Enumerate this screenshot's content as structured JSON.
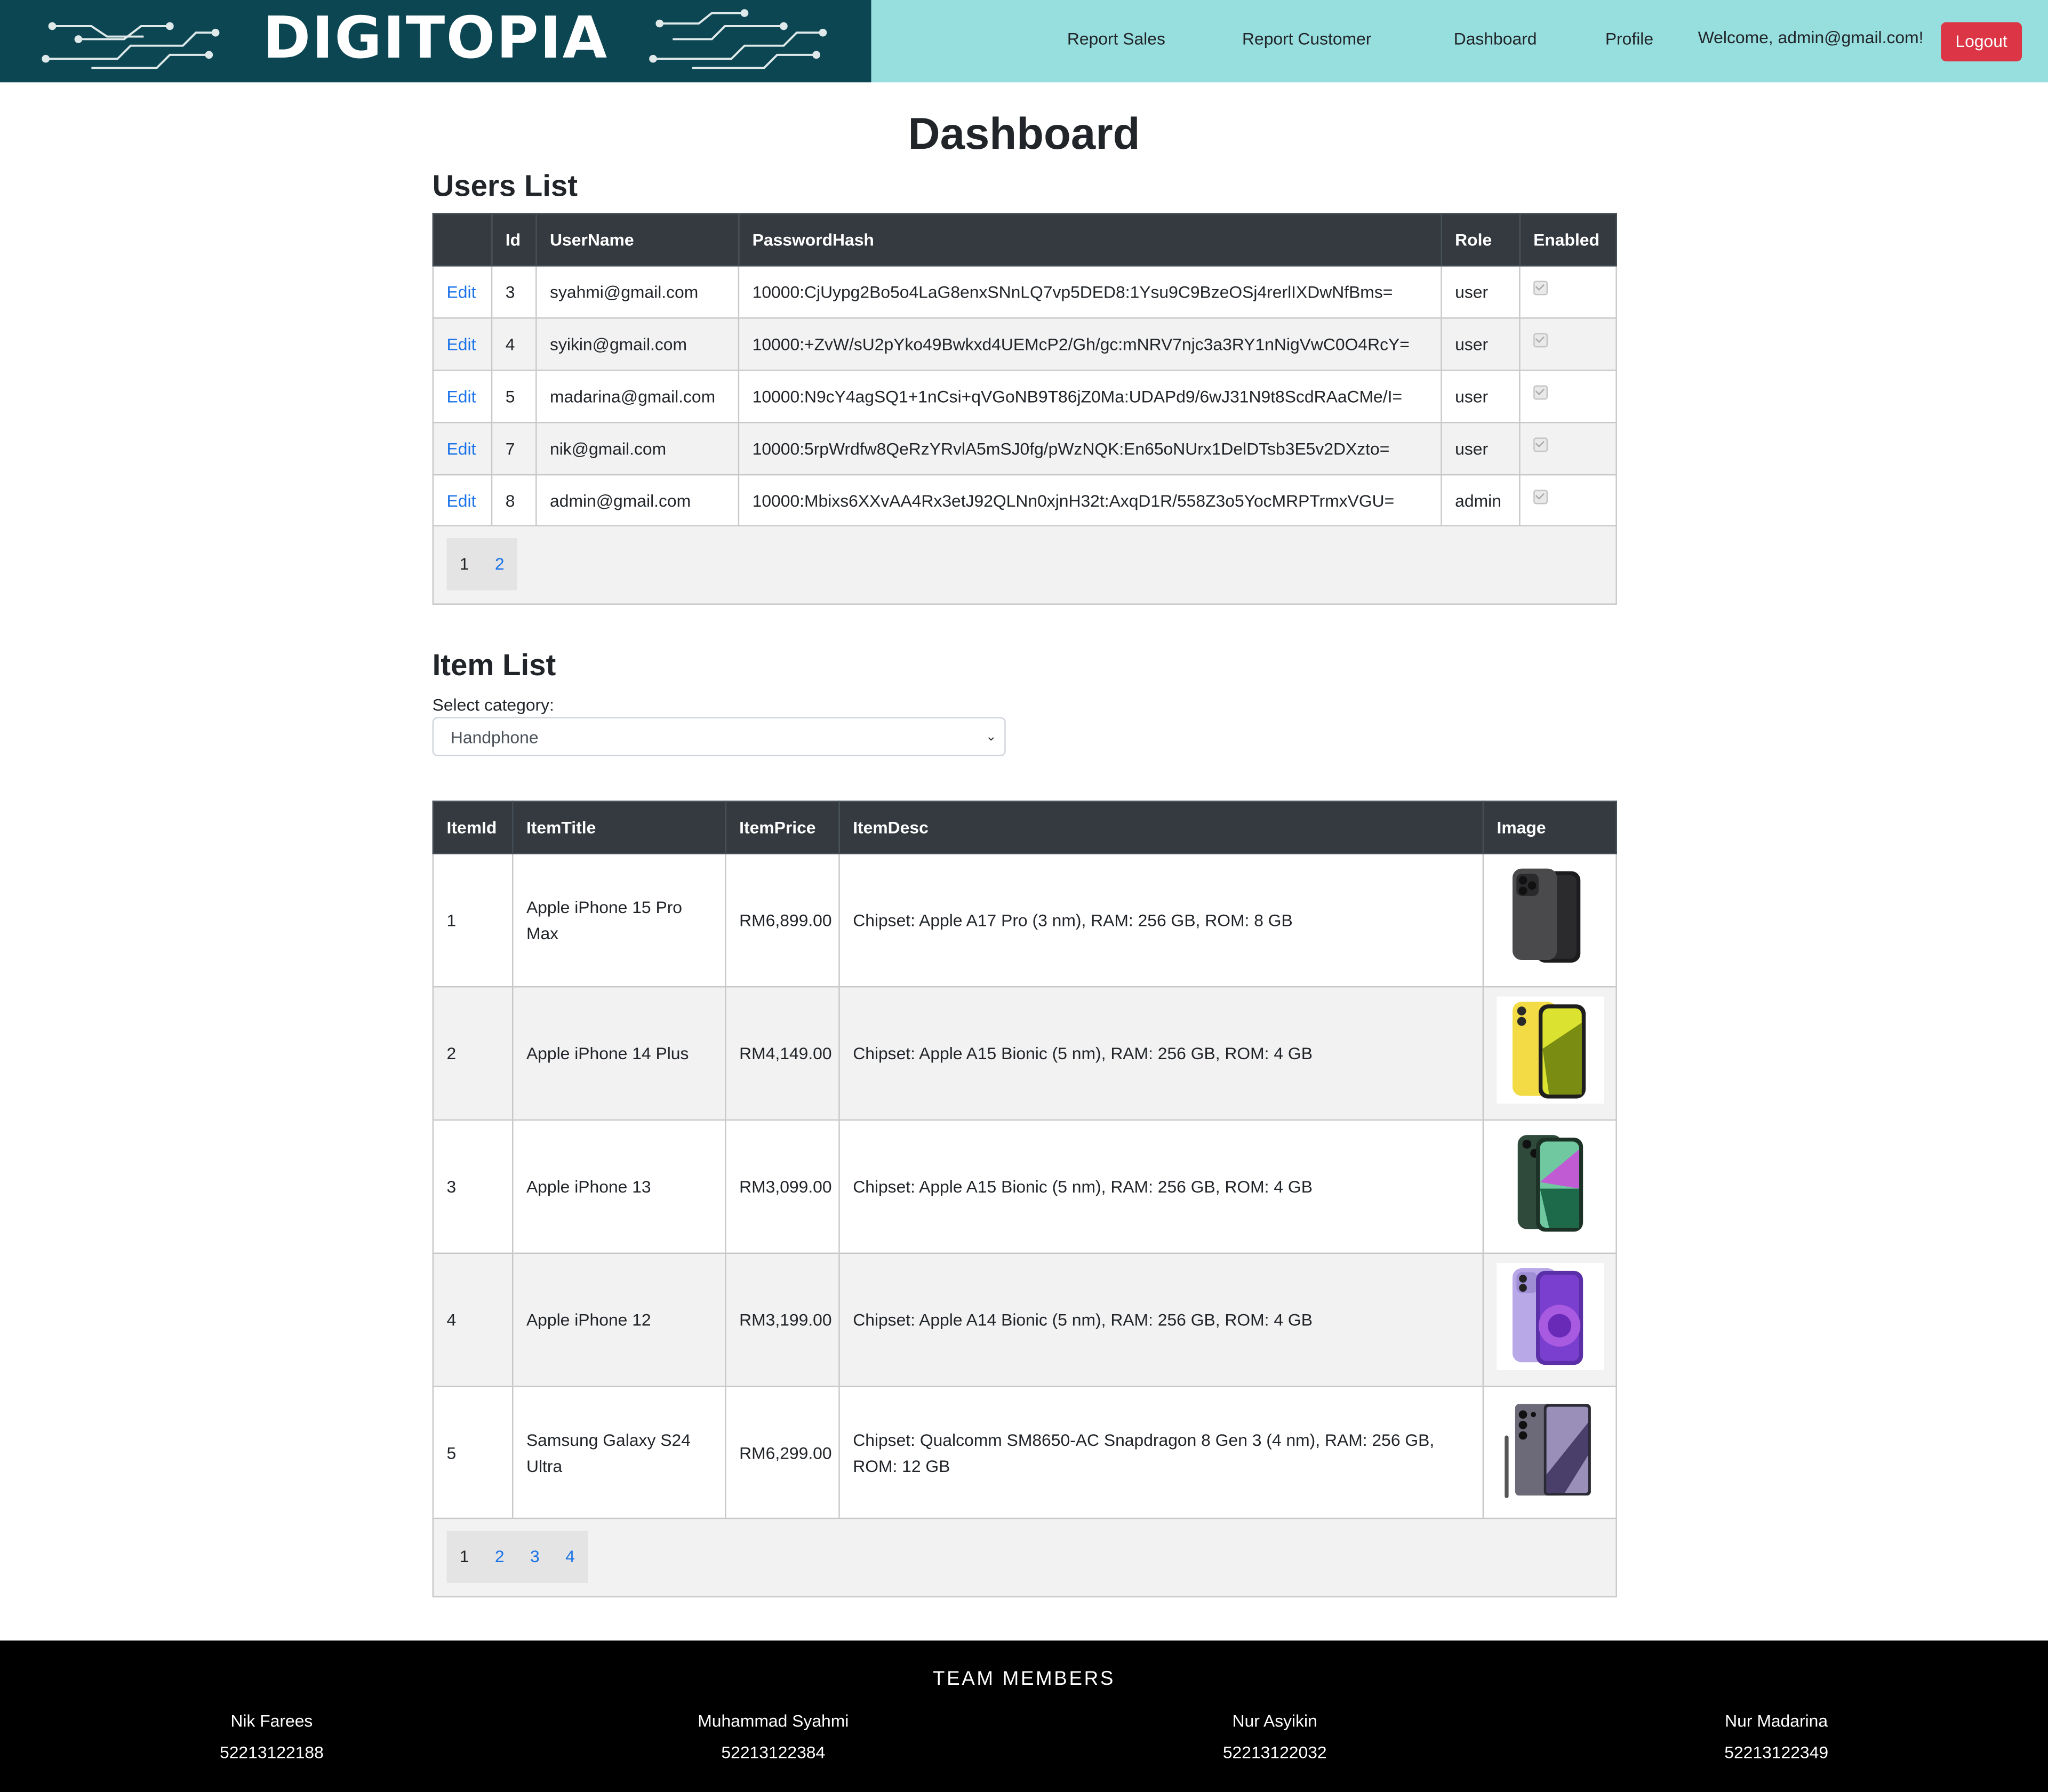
{
  "header": {
    "logo_text": "DIGITOPIA",
    "nav": [
      "Report Sales",
      "Report Customer",
      "Dashboard",
      "Profile"
    ],
    "welcome": "Welcome, admin@gmail.com!",
    "logout_label": "Logout"
  },
  "page_title": "Dashboard",
  "users": {
    "title": "Users List",
    "columns": [
      "",
      "Id",
      "UserName",
      "PasswordHash",
      "Role",
      "Enabled"
    ],
    "rows": [
      {
        "action": "Edit",
        "id": "3",
        "username": "syahmi@gmail.com",
        "hash": "10000:CjUypg2Bo5o4LaG8enxSNnLQ7vp5DED8:1Ysu9C9BzeOSj4rerlIXDwNfBms=",
        "role": "user",
        "enabled": true
      },
      {
        "action": "Edit",
        "id": "4",
        "username": "syikin@gmail.com",
        "hash": "10000:+ZvW/sU2pYko49Bwkxd4UEMcP2/Gh/gc:mNRV7njc3a3RY1nNigVwC0O4RcY=",
        "role": "user",
        "enabled": true
      },
      {
        "action": "Edit",
        "id": "5",
        "username": "madarina@gmail.com",
        "hash": "10000:N9cY4agSQ1+1nCsi+qVGoNB9T86jZ0Ma:UDAPd9/6wJ31N9t8ScdRAaCMe/I=",
        "role": "user",
        "enabled": true
      },
      {
        "action": "Edit",
        "id": "7",
        "username": "nik@gmail.com",
        "hash": "10000:5rpWrdfw8QeRzYRvlA5mSJ0fg/pWzNQK:En65oNUrx1DelDTsb3E5v2DXzto=",
        "role": "user",
        "enabled": true
      },
      {
        "action": "Edit",
        "id": "8",
        "username": "admin@gmail.com",
        "hash": "10000:Mbixs6XXvAA4Rx3etJ92QLNn0xjnH32t:AxqD1R/558Z3o5YocMRPTrmxVGU=",
        "role": "admin",
        "enabled": true
      }
    ],
    "pages": [
      "1",
      "2"
    ],
    "current_page": "1"
  },
  "items": {
    "title": "Item List",
    "select_label": "Select category:",
    "select_value": "Handphone",
    "columns": [
      "ItemId",
      "ItemTitle",
      "ItemPrice",
      "ItemDesc",
      "Image"
    ],
    "rows": [
      {
        "id": "1",
        "title": "Apple iPhone 15 Pro Max",
        "price": "RM6,899.00",
        "desc": "Chipset: Apple A17 Pro (3 nm), RAM: 256 GB, ROM: 8 GB",
        "image": "iphone-15-pro-max-image",
        "color": "#3a3a3c"
      },
      {
        "id": "2",
        "title": "Apple iPhone 14 Plus",
        "price": "RM4,149.00",
        "desc": "Chipset: Apple A15 Bionic (5 nm), RAM: 256 GB, ROM: 4 GB",
        "image": "iphone-14-plus-image",
        "color": "#f4df4e"
      },
      {
        "id": "3",
        "title": "Apple iPhone 13",
        "price": "RM3,099.00",
        "desc": "Chipset: Apple A15 Bionic (5 nm), RAM: 256 GB, ROM: 4 GB",
        "image": "iphone-13-image",
        "color": "#2f4a3a"
      },
      {
        "id": "4",
        "title": "Apple iPhone 12",
        "price": "RM3,199.00",
        "desc": "Chipset: Apple A14 Bionic (5 nm), RAM: 256 GB, ROM: 4 GB",
        "image": "iphone-12-image",
        "color": "#b9a8e8"
      },
      {
        "id": "5",
        "title": "Samsung Galaxy S24 Ultra",
        "price": "RM6,299.00",
        "desc": "Chipset: Qualcomm SM8650-AC Snapdragon 8 Gen 3 (4 nm), RAM: 256 GB, ROM: 12 GB",
        "image": "galaxy-s24-ultra-image",
        "color": "#6f6a86"
      }
    ],
    "pages": [
      "1",
      "2",
      "3",
      "4"
    ],
    "current_page": "1"
  },
  "footer": {
    "title": "TEAM MEMBERS",
    "members": [
      {
        "name": "Nik Farees",
        "id": "52213122188"
      },
      {
        "name": "Muhammad Syahmi",
        "id": "52213122384"
      },
      {
        "name": "Nur Asyikin",
        "id": "52213122032"
      },
      {
        "name": "Nur Madarina",
        "id": "52213122349"
      }
    ]
  },
  "colors": {
    "header_bg": "#97dede",
    "logo_bg": "#0b4652",
    "table_header": "#343a40",
    "link": "#1a73e8",
    "logout": "#dc3545",
    "footer_bg": "#000000"
  }
}
